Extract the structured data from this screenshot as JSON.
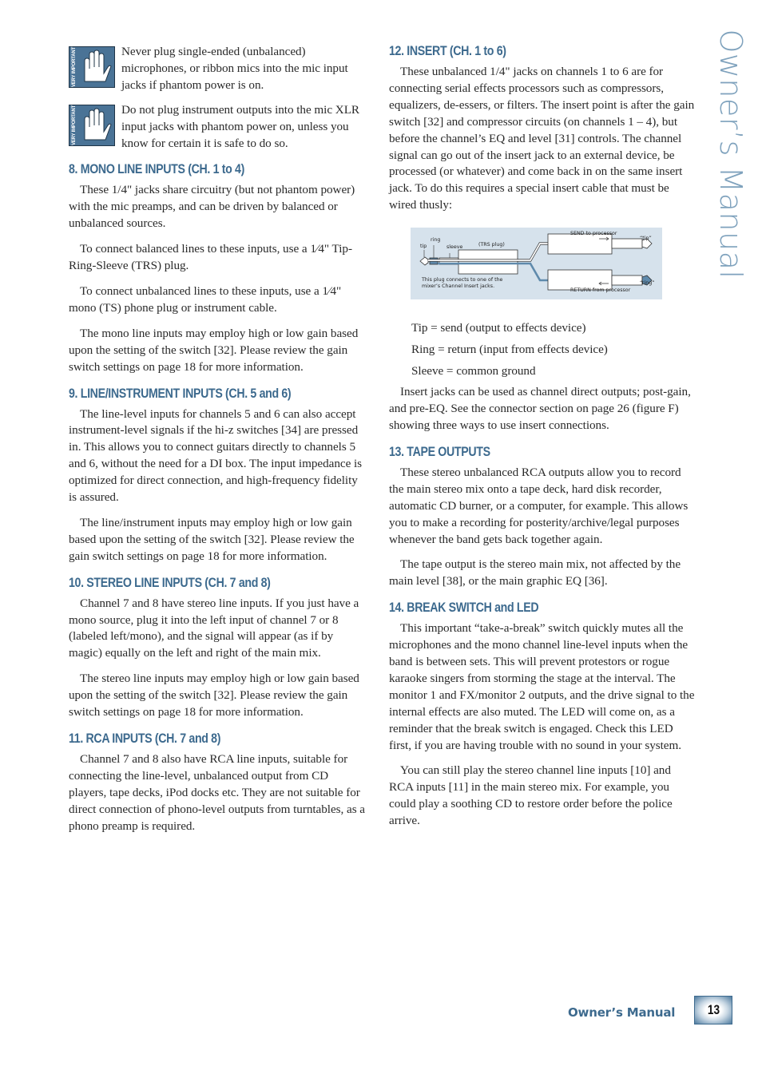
{
  "side_title": "Owner’s Manual",
  "footer": {
    "title": "Owner’s Manual",
    "page_number": "13"
  },
  "warnings": [
    {
      "icon": "very-important-hand-icon",
      "icon_label": "VERY IMPORTANT",
      "text": "Never plug single-ended (unbalanced) microphones, or ribbon mics into the mic input jacks if phantom power is on."
    },
    {
      "icon": "very-important-hand-icon",
      "icon_label": "VERY IMPORTANT",
      "text": "Do not plug instrument outputs into the mic XLR input jacks with phantom power on, unless you know for certain it is safe to do so."
    }
  ],
  "sections": {
    "s8": {
      "heading": "8. MONO LINE INPUTS (CH. 1 to 4)",
      "paragraphs": [
        "These 1/4\" jacks share circuitry (but not phantom power) with the mic preamps, and can be driven by balanced or unbalanced sources.",
        "To connect balanced lines to these inputs, use a 1⁄4\" Tip-Ring-Sleeve (TRS) plug.",
        "To connect unbalanced lines to these inputs, use a 1⁄4\" mono (TS) phone plug or instrument cable.",
        "The mono line inputs may employ high or low gain based upon the setting of the switch [32]. Please review the gain switch settings on page 18 for more information."
      ]
    },
    "s9": {
      "heading": "9. LINE/INSTRUMENT INPUTS (CH. 5 and 6)",
      "paragraphs": [
        "The line-level inputs for channels 5 and 6 can also accept instrument-level signals if the hi-z switches [34] are pressed in. This allows you to connect guitars directly to channels 5 and 6, without the need for a DI box. The input impedance is optimized for direct connection, and high-frequency fidelity is assured.",
        "The line/instrument inputs may employ high or low gain based upon the setting of the switch [32]. Please review the gain switch settings on page 18 for more information."
      ]
    },
    "s10": {
      "heading": "10. STEREO LINE INPUTS (CH. 7 and 8)",
      "paragraphs": [
        "Channel 7 and 8 have stereo line inputs. If you just have a mono source, plug it into the left input of channel 7 or 8 (labeled left/mono), and the signal will appear (as if by magic) equally on the left and right of the main mix.",
        "The stereo line inputs may employ high or low gain based upon the setting of the switch [32]. Please review the gain switch settings on page 18 for more information."
      ]
    },
    "s11": {
      "heading": "11. RCA INPUTS (CH. 7 and 8)",
      "paragraphs": [
        "Channel 7 and 8 also have RCA line inputs, suitable for connecting the line-level, unbalanced output from CD players, tape decks, iPod docks etc. They are not suitable for direct connection of phono-level outputs from turntables, as a phono preamp is required."
      ]
    },
    "s12": {
      "heading": "12. INSERT (CH. 1 to 6)",
      "paragraphs": [
        "These unbalanced 1/4\" jacks on channels 1 to 6 are for connecting serial effects processors such as compressors, equalizers, de-essers, or filters. The insert point is after the gain switch [32] and compressor circuits (on channels 1 – 4), but before the channel’s EQ and level [31] controls. The channel signal can go out of the insert jack to an external device, be processed (or whatever) and come back in on the same insert jack. To do this requires a special insert cable that must be wired thusly:"
      ],
      "wiring": [
        "Tip = send (output to effects device)",
        "Ring = return (input from effects device)",
        "Sleeve = common ground"
      ],
      "after": [
        "Insert jacks can be used as channel direct outputs; post-gain, and pre-EQ. See the connector section on page 26 (figure F) showing three ways to use insert connections."
      ]
    },
    "s13": {
      "heading": "13. TAPE OUTPUTS",
      "paragraphs": [
        "These stereo unbalanced RCA outputs allow you to record the main stereo mix onto a tape deck, hard disk recorder, automatic CD burner, or a computer, for example. This allows you to make a recording for posterity/archive/legal purposes whenever the band gets back together again.",
        "The tape output is the stereo main mix, not affected by the main level [38], or the main graphic EQ [36]."
      ]
    },
    "s14": {
      "heading": "14. BREAK SWITCH and LED",
      "paragraphs": [
        "This important “take-a-break” switch quickly mutes all the microphones and the mono channel line-level inputs when the band is between sets. This will prevent protestors or rogue karaoke singers from storming the stage at the interval. The monitor 1 and FX/monitor 2 outputs, and the drive signal to the internal effects are also muted. The LED will come on, as a reminder that the break switch is engaged. Check this LED first, if you are having trouble with no sound in your system.",
        "You can still play the stereo channel line inputs [10] and RCA inputs [11] in the main stereo mix. For example, you could play a soothing CD to restore order before the police arrive."
      ]
    }
  },
  "diagram": {
    "labels": {
      "tip": "tip",
      "ring": "ring",
      "sleeve": "sleeve",
      "trs_plug": "(TRS plug)",
      "send": "SEND to processor",
      "return": "RETURN from processor",
      "tip_quoted": "“tip”",
      "ring_quoted": "“ring”",
      "caption_line1": "This plug connects to one of the",
      "caption_line2": "mixer’s Channel Insert jacks."
    },
    "colors": {
      "background": "#d6e2ec",
      "return_wire": "#5f8aac",
      "plug_body": "#ffffff"
    }
  },
  "colors": {
    "heading": "#3d6a8e",
    "side_title": "#7fa2bd",
    "icon_bg": "#4a7396"
  }
}
